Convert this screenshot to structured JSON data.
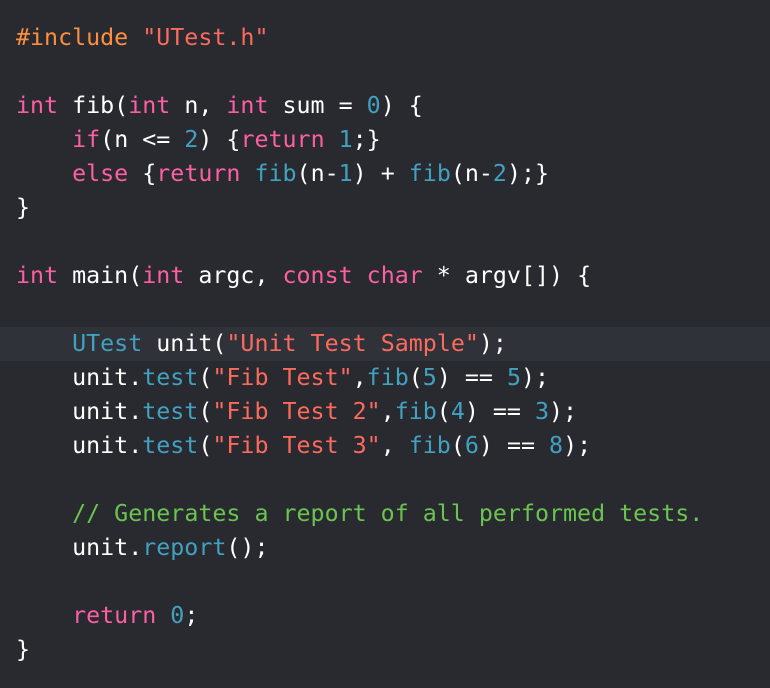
{
  "editor": {
    "theme": {
      "background": "#292a30",
      "current_line": "#2f3239",
      "plain": "#ffffff",
      "keyword": "#fc5fa3",
      "preprocessor": "#fd8f3f",
      "string": "#fc6a5d",
      "number": "#d0bf69",
      "number_alt": "#41a1c0",
      "function": "#41a1c0",
      "type": "#41a1c0",
      "comment": "#6bc350"
    },
    "current_line_index": 9,
    "lines": [
      [
        {
          "t": "preprocessor",
          "v": "#include "
        },
        {
          "t": "string",
          "v": "\"UTest.h\""
        }
      ],
      [],
      [
        {
          "t": "keyword",
          "v": "int"
        },
        {
          "t": "plain",
          "v": " fib("
        },
        {
          "t": "keyword",
          "v": "int"
        },
        {
          "t": "plain",
          "v": " n, "
        },
        {
          "t": "keyword",
          "v": "int"
        },
        {
          "t": "plain",
          "v": " sum = "
        },
        {
          "t": "number_alt",
          "v": "0"
        },
        {
          "t": "plain",
          "v": ") {"
        }
      ],
      [
        {
          "t": "plain",
          "v": "    "
        },
        {
          "t": "keyword",
          "v": "if"
        },
        {
          "t": "plain",
          "v": "(n <= "
        },
        {
          "t": "number_alt",
          "v": "2"
        },
        {
          "t": "plain",
          "v": ") {"
        },
        {
          "t": "keyword",
          "v": "return"
        },
        {
          "t": "plain",
          "v": " "
        },
        {
          "t": "number_alt",
          "v": "1"
        },
        {
          "t": "plain",
          "v": ";}"
        }
      ],
      [
        {
          "t": "plain",
          "v": "    "
        },
        {
          "t": "keyword",
          "v": "else"
        },
        {
          "t": "plain",
          "v": " {"
        },
        {
          "t": "keyword",
          "v": "return"
        },
        {
          "t": "plain",
          "v": " "
        },
        {
          "t": "function",
          "v": "fib"
        },
        {
          "t": "plain",
          "v": "(n-"
        },
        {
          "t": "number_alt",
          "v": "1"
        },
        {
          "t": "plain",
          "v": ") + "
        },
        {
          "t": "function",
          "v": "fib"
        },
        {
          "t": "plain",
          "v": "(n-"
        },
        {
          "t": "number_alt",
          "v": "2"
        },
        {
          "t": "plain",
          "v": ");}"
        }
      ],
      [
        {
          "t": "plain",
          "v": "}"
        }
      ],
      [],
      [
        {
          "t": "keyword",
          "v": "int"
        },
        {
          "t": "plain",
          "v": " main("
        },
        {
          "t": "keyword",
          "v": "int"
        },
        {
          "t": "plain",
          "v": " argc, "
        },
        {
          "t": "keyword",
          "v": "const"
        },
        {
          "t": "plain",
          "v": " "
        },
        {
          "t": "keyword",
          "v": "char"
        },
        {
          "t": "plain",
          "v": " * argv[]) {"
        }
      ],
      [],
      [
        {
          "t": "plain",
          "v": "    "
        },
        {
          "t": "type",
          "v": "UTest"
        },
        {
          "t": "plain",
          "v": " unit("
        },
        {
          "t": "string",
          "v": "\"Unit Test Sample\""
        },
        {
          "t": "plain",
          "v": ");"
        }
      ],
      [
        {
          "t": "plain",
          "v": "    unit."
        },
        {
          "t": "function",
          "v": "test"
        },
        {
          "t": "plain",
          "v": "("
        },
        {
          "t": "string",
          "v": "\"Fib Test\""
        },
        {
          "t": "plain",
          "v": ","
        },
        {
          "t": "function",
          "v": "fib"
        },
        {
          "t": "plain",
          "v": "("
        },
        {
          "t": "number_alt",
          "v": "5"
        },
        {
          "t": "plain",
          "v": ") == "
        },
        {
          "t": "number_alt",
          "v": "5"
        },
        {
          "t": "plain",
          "v": ");"
        }
      ],
      [
        {
          "t": "plain",
          "v": "    unit."
        },
        {
          "t": "function",
          "v": "test"
        },
        {
          "t": "plain",
          "v": "("
        },
        {
          "t": "string",
          "v": "\"Fib Test 2\""
        },
        {
          "t": "plain",
          "v": ","
        },
        {
          "t": "function",
          "v": "fib"
        },
        {
          "t": "plain",
          "v": "("
        },
        {
          "t": "number_alt",
          "v": "4"
        },
        {
          "t": "plain",
          "v": ") == "
        },
        {
          "t": "number_alt",
          "v": "3"
        },
        {
          "t": "plain",
          "v": ");"
        }
      ],
      [
        {
          "t": "plain",
          "v": "    unit."
        },
        {
          "t": "function",
          "v": "test"
        },
        {
          "t": "plain",
          "v": "("
        },
        {
          "t": "string",
          "v": "\"Fib Test 3\""
        },
        {
          "t": "plain",
          "v": ", "
        },
        {
          "t": "function",
          "v": "fib"
        },
        {
          "t": "plain",
          "v": "("
        },
        {
          "t": "number_alt",
          "v": "6"
        },
        {
          "t": "plain",
          "v": ") == "
        },
        {
          "t": "number_alt",
          "v": "8"
        },
        {
          "t": "plain",
          "v": ");"
        }
      ],
      [],
      [
        {
          "t": "plain",
          "v": "    "
        },
        {
          "t": "comment",
          "v": "// Generates a report of all performed tests."
        }
      ],
      [
        {
          "t": "plain",
          "v": "    unit."
        },
        {
          "t": "function",
          "v": "report"
        },
        {
          "t": "plain",
          "v": "();"
        }
      ],
      [],
      [
        {
          "t": "plain",
          "v": "    "
        },
        {
          "t": "keyword",
          "v": "return"
        },
        {
          "t": "plain",
          "v": " "
        },
        {
          "t": "number_alt",
          "v": "0"
        },
        {
          "t": "plain",
          "v": ";"
        }
      ],
      [
        {
          "t": "plain",
          "v": "}"
        }
      ]
    ]
  }
}
